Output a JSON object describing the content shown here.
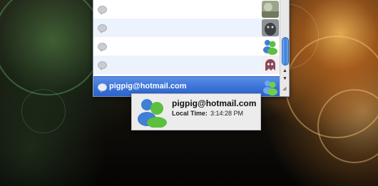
{
  "contact_list": {
    "rows": [
      {
        "status_icon": "speech-bubble-icon",
        "avatar": "photo-avatar-landscape"
      },
      {
        "status_icon": "speech-bubble-icon",
        "avatar": "photo-avatar-animal"
      },
      {
        "status_icon": "speech-bubble-icon",
        "avatar": "msn-buddies-avatar"
      },
      {
        "status_icon": "speech-bubble-icon",
        "avatar": "ghost-avatar"
      },
      {
        "status_icon": "speech-bubble-icon",
        "avatar": "msn-buddies-avatar",
        "email": "pigpig@hotmail.com",
        "selected": true
      }
    ]
  },
  "tooltip": {
    "email": "pigpig@hotmail.com",
    "local_time_label": "Local Time:",
    "local_time": "3:14:28 PM",
    "icon": "msn-buddies-icon"
  },
  "colors": {
    "selection": "#3b73d9",
    "alt_row": "#edf3fd",
    "tooltip_bg": "#ececec"
  }
}
